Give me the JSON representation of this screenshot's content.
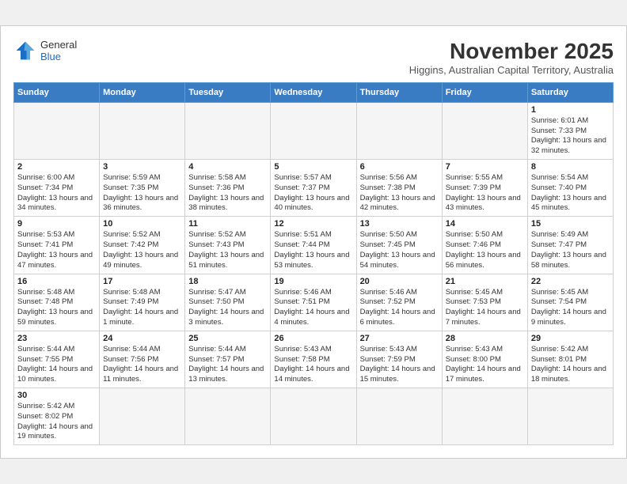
{
  "header": {
    "logo_general": "General",
    "logo_blue": "Blue",
    "month_title": "November 2025",
    "subtitle": "Higgins, Australian Capital Territory, Australia"
  },
  "weekdays": [
    "Sunday",
    "Monday",
    "Tuesday",
    "Wednesday",
    "Thursday",
    "Friday",
    "Saturday"
  ],
  "weeks": [
    [
      {
        "day": "",
        "info": ""
      },
      {
        "day": "",
        "info": ""
      },
      {
        "day": "",
        "info": ""
      },
      {
        "day": "",
        "info": ""
      },
      {
        "day": "",
        "info": ""
      },
      {
        "day": "",
        "info": ""
      },
      {
        "day": "1",
        "info": "Sunrise: 6:01 AM\nSunset: 7:33 PM\nDaylight: 13 hours\nand 32 minutes."
      }
    ],
    [
      {
        "day": "2",
        "info": "Sunrise: 6:00 AM\nSunset: 7:34 PM\nDaylight: 13 hours\nand 34 minutes."
      },
      {
        "day": "3",
        "info": "Sunrise: 5:59 AM\nSunset: 7:35 PM\nDaylight: 13 hours\nand 36 minutes."
      },
      {
        "day": "4",
        "info": "Sunrise: 5:58 AM\nSunset: 7:36 PM\nDaylight: 13 hours\nand 38 minutes."
      },
      {
        "day": "5",
        "info": "Sunrise: 5:57 AM\nSunset: 7:37 PM\nDaylight: 13 hours\nand 40 minutes."
      },
      {
        "day": "6",
        "info": "Sunrise: 5:56 AM\nSunset: 7:38 PM\nDaylight: 13 hours\nand 42 minutes."
      },
      {
        "day": "7",
        "info": "Sunrise: 5:55 AM\nSunset: 7:39 PM\nDaylight: 13 hours\nand 43 minutes."
      },
      {
        "day": "8",
        "info": "Sunrise: 5:54 AM\nSunset: 7:40 PM\nDaylight: 13 hours\nand 45 minutes."
      }
    ],
    [
      {
        "day": "9",
        "info": "Sunrise: 5:53 AM\nSunset: 7:41 PM\nDaylight: 13 hours\nand 47 minutes."
      },
      {
        "day": "10",
        "info": "Sunrise: 5:52 AM\nSunset: 7:42 PM\nDaylight: 13 hours\nand 49 minutes."
      },
      {
        "day": "11",
        "info": "Sunrise: 5:52 AM\nSunset: 7:43 PM\nDaylight: 13 hours\nand 51 minutes."
      },
      {
        "day": "12",
        "info": "Sunrise: 5:51 AM\nSunset: 7:44 PM\nDaylight: 13 hours\nand 53 minutes."
      },
      {
        "day": "13",
        "info": "Sunrise: 5:50 AM\nSunset: 7:45 PM\nDaylight: 13 hours\nand 54 minutes."
      },
      {
        "day": "14",
        "info": "Sunrise: 5:50 AM\nSunset: 7:46 PM\nDaylight: 13 hours\nand 56 minutes."
      },
      {
        "day": "15",
        "info": "Sunrise: 5:49 AM\nSunset: 7:47 PM\nDaylight: 13 hours\nand 58 minutes."
      }
    ],
    [
      {
        "day": "16",
        "info": "Sunrise: 5:48 AM\nSunset: 7:48 PM\nDaylight: 13 hours\nand 59 minutes."
      },
      {
        "day": "17",
        "info": "Sunrise: 5:48 AM\nSunset: 7:49 PM\nDaylight: 14 hours\nand 1 minute."
      },
      {
        "day": "18",
        "info": "Sunrise: 5:47 AM\nSunset: 7:50 PM\nDaylight: 14 hours\nand 3 minutes."
      },
      {
        "day": "19",
        "info": "Sunrise: 5:46 AM\nSunset: 7:51 PM\nDaylight: 14 hours\nand 4 minutes."
      },
      {
        "day": "20",
        "info": "Sunrise: 5:46 AM\nSunset: 7:52 PM\nDaylight: 14 hours\nand 6 minutes."
      },
      {
        "day": "21",
        "info": "Sunrise: 5:45 AM\nSunset: 7:53 PM\nDaylight: 14 hours\nand 7 minutes."
      },
      {
        "day": "22",
        "info": "Sunrise: 5:45 AM\nSunset: 7:54 PM\nDaylight: 14 hours\nand 9 minutes."
      }
    ],
    [
      {
        "day": "23",
        "info": "Sunrise: 5:44 AM\nSunset: 7:55 PM\nDaylight: 14 hours\nand 10 minutes."
      },
      {
        "day": "24",
        "info": "Sunrise: 5:44 AM\nSunset: 7:56 PM\nDaylight: 14 hours\nand 11 minutes."
      },
      {
        "day": "25",
        "info": "Sunrise: 5:44 AM\nSunset: 7:57 PM\nDaylight: 14 hours\nand 13 minutes."
      },
      {
        "day": "26",
        "info": "Sunrise: 5:43 AM\nSunset: 7:58 PM\nDaylight: 14 hours\nand 14 minutes."
      },
      {
        "day": "27",
        "info": "Sunrise: 5:43 AM\nSunset: 7:59 PM\nDaylight: 14 hours\nand 15 minutes."
      },
      {
        "day": "28",
        "info": "Sunrise: 5:43 AM\nSunset: 8:00 PM\nDaylight: 14 hours\nand 17 minutes."
      },
      {
        "day": "29",
        "info": "Sunrise: 5:42 AM\nSunset: 8:01 PM\nDaylight: 14 hours\nand 18 minutes."
      }
    ],
    [
      {
        "day": "30",
        "info": "Sunrise: 5:42 AM\nSunset: 8:02 PM\nDaylight: 14 hours\nand 19 minutes."
      },
      {
        "day": "",
        "info": ""
      },
      {
        "day": "",
        "info": ""
      },
      {
        "day": "",
        "info": ""
      },
      {
        "day": "",
        "info": ""
      },
      {
        "day": "",
        "info": ""
      },
      {
        "day": "",
        "info": ""
      }
    ]
  ]
}
